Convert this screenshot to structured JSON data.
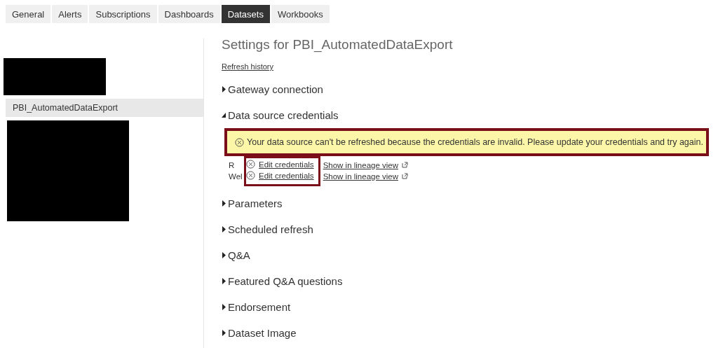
{
  "tabs": [
    {
      "label": "General",
      "selected": false
    },
    {
      "label": "Alerts",
      "selected": false
    },
    {
      "label": "Subscriptions",
      "selected": false
    },
    {
      "label": "Dashboards",
      "selected": false
    },
    {
      "label": "Datasets",
      "selected": true
    },
    {
      "label": "Workbooks",
      "selected": false
    }
  ],
  "sidebar": {
    "items": [
      {
        "kind": "redacted"
      },
      {
        "kind": "dataset",
        "label": "PBI_AutomatedDataExport",
        "selected": true
      },
      {
        "kind": "redacted"
      }
    ]
  },
  "settings": {
    "title": "Settings for PBI_AutomatedDataExport",
    "refresh_link": "Refresh history",
    "sections": [
      {
        "label": "Gateway connection",
        "expanded": false
      },
      {
        "label": "Data source credentials",
        "expanded": true,
        "error": "Your data source can't be refreshed because the credentials are invalid. Please update your credentials and try again.",
        "sources": [
          {
            "name": "R",
            "edit": "Edit credentials",
            "lineage": "Show in lineage view"
          },
          {
            "name": "Wel",
            "edit": "Edit credentials",
            "lineage": "Show in lineage view"
          }
        ]
      },
      {
        "label": "Parameters",
        "expanded": false
      },
      {
        "label": "Scheduled refresh",
        "expanded": false
      },
      {
        "label": "Q&A",
        "expanded": false
      },
      {
        "label": "Featured Q&A questions",
        "expanded": false
      },
      {
        "label": "Endorsement",
        "expanded": false
      },
      {
        "label": "Dataset Image",
        "expanded": false
      }
    ]
  }
}
